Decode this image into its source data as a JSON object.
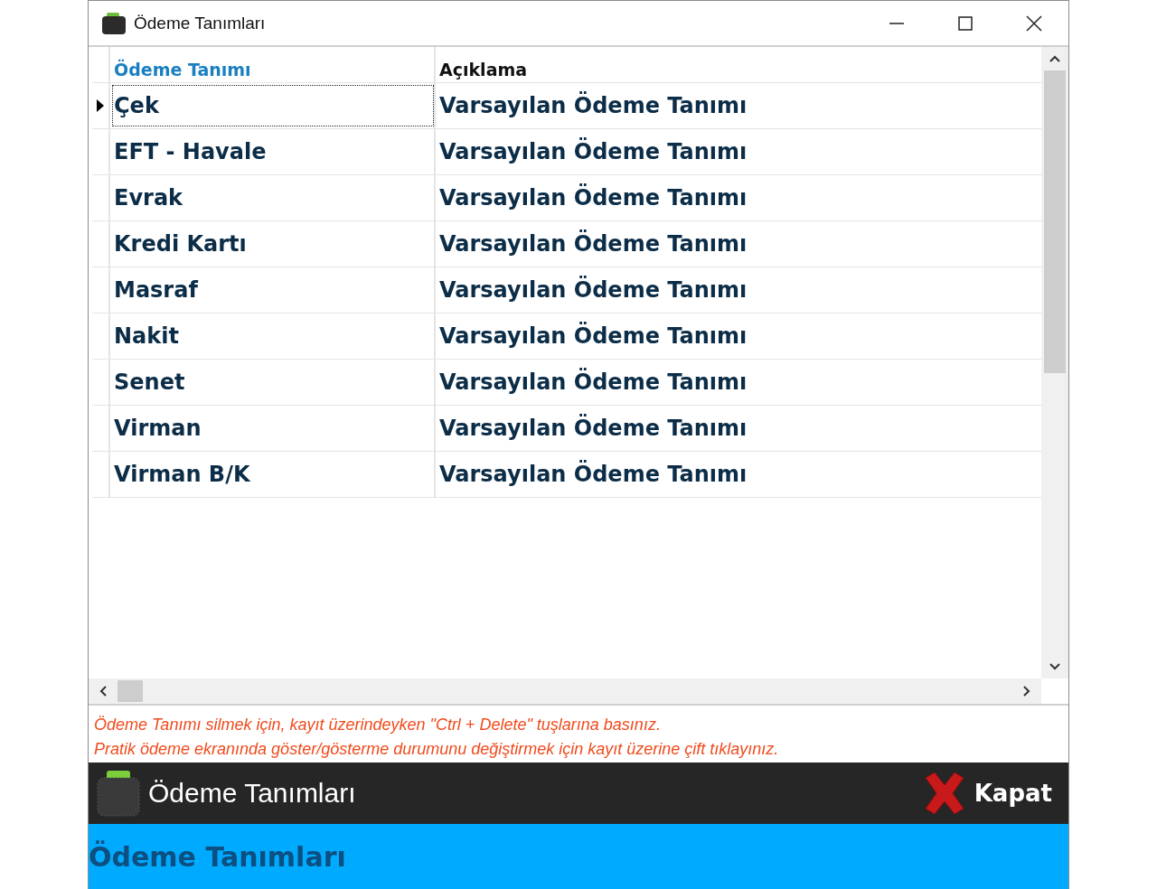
{
  "window": {
    "title": "Ödeme Tanımları"
  },
  "table": {
    "columns": [
      "Ödeme Tanımı",
      "Açıklama"
    ],
    "rows": [
      {
        "name": "Çek",
        "description": "Varsayılan Ödeme Tanımı",
        "selected": true
      },
      {
        "name": "EFT - Havale",
        "description": "Varsayılan Ödeme Tanımı",
        "selected": false
      },
      {
        "name": "Evrak",
        "description": "Varsayılan Ödeme Tanımı",
        "selected": false
      },
      {
        "name": "Kredi Kartı",
        "description": "Varsayılan Ödeme Tanımı",
        "selected": false
      },
      {
        "name": "Masraf",
        "description": "Varsayılan Ödeme Tanımı",
        "selected": false
      },
      {
        "name": "Nakit",
        "description": "Varsayılan Ödeme Tanımı",
        "selected": false
      },
      {
        "name": "Senet",
        "description": "Varsayılan Ödeme Tanımı",
        "selected": false
      },
      {
        "name": "Virman",
        "description": "Varsayılan Ödeme Tanımı",
        "selected": false
      },
      {
        "name": "Virman B/K",
        "description": "Varsayılan Ödeme Tanımı",
        "selected": false
      }
    ]
  },
  "hints": [
    "Ödeme Tanımı silmek için, kayıt üzerindeyken \"Ctrl + Delete\" tuşlarına basınız.",
    "Pratik ödeme ekranında göster/gösterme durumunu değiştirmek için kayıt üzerine çift tıklayınız."
  ],
  "toolbar": {
    "title": "Ödeme Tanımları",
    "close_label": "Kapat"
  },
  "footer": {
    "title": "Ödeme Tanımları"
  }
}
